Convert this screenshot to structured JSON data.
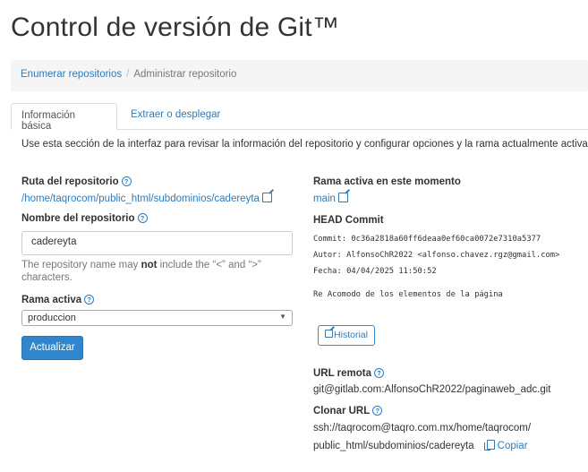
{
  "page": {
    "title": "Control de versión de Git™"
  },
  "breadcrumb": {
    "link": "Enumerar repositorios",
    "separator": "/",
    "current": "Administrar repositorio"
  },
  "tabs": [
    {
      "label": "Información básica",
      "active": true
    },
    {
      "label": "Extraer o desplegar",
      "active": false
    }
  ],
  "description": "Use esta sección de la interfaz para revisar la información del repositorio y configurar opciones y la rama actualmente activa.",
  "left": {
    "path_label": "Ruta del repositorio",
    "path_value": "/home/taqrocom/public_html/subdominios/cadereyta",
    "name_label": "Nombre del repositorio",
    "name_value": "cadereyta",
    "hint_pre": "The repository name may ",
    "hint_bold": "not",
    "hint_post": " include the “<” and “>” characters.",
    "branch_label": "Rama activa",
    "branch_selected": "produccion",
    "update_button": "Actualizar"
  },
  "right": {
    "active_branch_label": "Rama activa en este momento",
    "active_branch_value": "main",
    "head_label": "HEAD Commit",
    "commit_line": "Commit: 0c36a2818a60ff6deaa0ef60ca0072e7310a5377",
    "author_line": "Autor: AlfonsoChR2022 <alfonso.chavez.rgz@gmail.com>",
    "date_line": "Fecha: 04/04/2025 11:50:52",
    "message_line": "Re Acomodo de los elementos de la página",
    "history_button": "Historial",
    "remote_label": "URL remota",
    "remote_value": "git@gitlab.com:AlfonsoChR2022/paginaweb_adc.git",
    "clone_label": "Clonar URL",
    "clone_line1": "ssh://taqrocom@taqro.com.mx/home/taqrocom/",
    "clone_line2": "public_html/subdominios/cadereyta",
    "copy_label": "Copiar"
  },
  "icons": {
    "help": "question-circle-icon",
    "external": "external-link-icon",
    "copy": "copy-icon"
  },
  "colors": {
    "link": "#2d7bbd",
    "primary_button": "#2f86cc"
  }
}
